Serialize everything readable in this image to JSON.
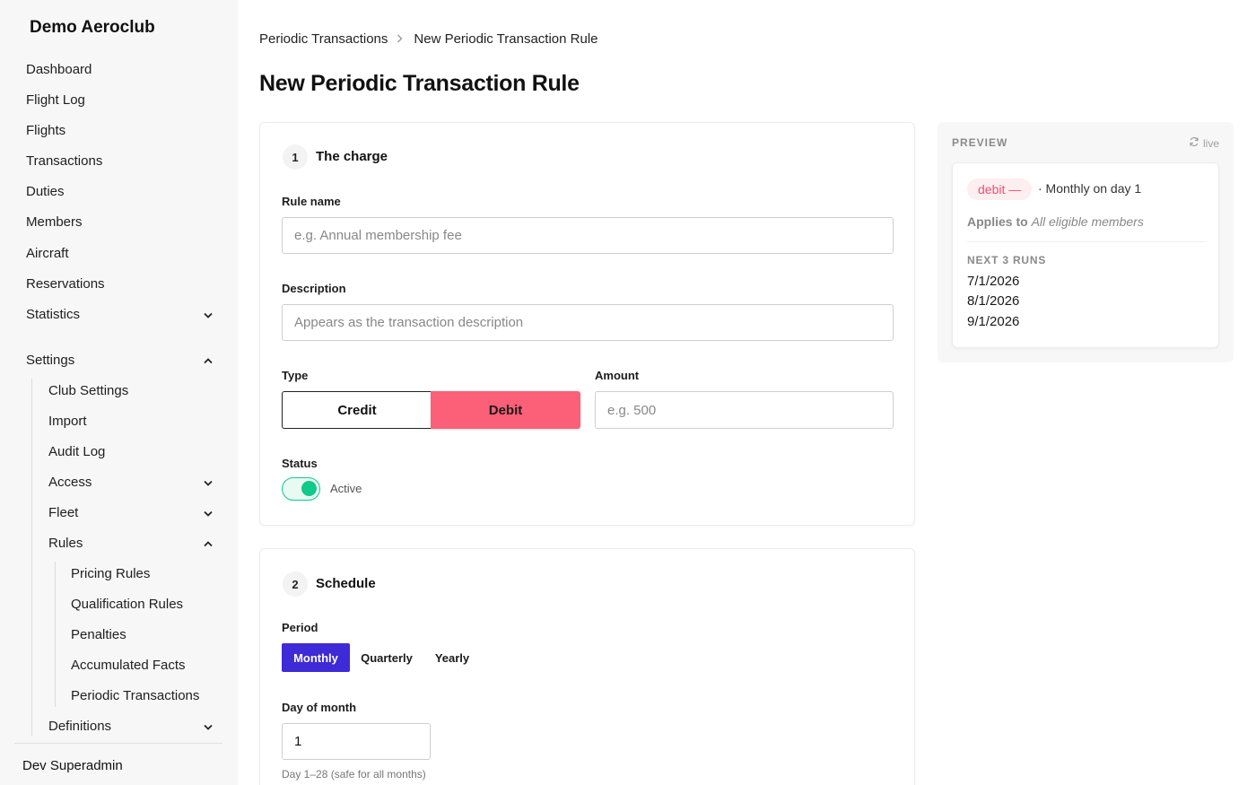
{
  "sidebar": {
    "club_name": "Demo Aeroclub",
    "items": [
      {
        "label": "Dashboard"
      },
      {
        "label": "Flight Log"
      },
      {
        "label": "Flights"
      },
      {
        "label": "Transactions"
      },
      {
        "label": "Duties"
      },
      {
        "label": "Members"
      },
      {
        "label": "Aircraft"
      },
      {
        "label": "Reservations"
      },
      {
        "label": "Statistics",
        "expanded": false
      },
      {
        "label": "Settings",
        "expanded": true
      }
    ],
    "settings_children": [
      {
        "label": "Club Settings"
      },
      {
        "label": "Import"
      },
      {
        "label": "Audit Log"
      },
      {
        "label": "Access",
        "expanded": false
      },
      {
        "label": "Fleet",
        "expanded": false
      },
      {
        "label": "Rules",
        "expanded": true
      },
      {
        "label": "Definitions",
        "expanded": false
      }
    ],
    "rules_children": [
      {
        "label": "Pricing Rules"
      },
      {
        "label": "Qualification Rules"
      },
      {
        "label": "Penalties"
      },
      {
        "label": "Accumulated Facts"
      },
      {
        "label": "Periodic Transactions"
      }
    ],
    "user_name": "Dev Superadmin"
  },
  "breadcrumb": [
    "Periodic Transactions",
    "New Periodic Transaction Rule"
  ],
  "page_title": "New Periodic Transaction Rule",
  "charge": {
    "step": "1",
    "title": "The charge",
    "rule_name_label": "Rule name",
    "rule_name_placeholder": "e.g. Annual membership fee",
    "description_label": "Description",
    "description_placeholder": "Appears as the transaction description",
    "type_label": "Type",
    "type_options": [
      "Credit",
      "Debit"
    ],
    "type_selected": "Debit",
    "amount_label": "Amount",
    "amount_placeholder": "e.g. 500",
    "status_label": "Status",
    "status_value": "Active",
    "status_on": true
  },
  "schedule": {
    "step": "2",
    "title": "Schedule",
    "period_label": "Period",
    "period_options": [
      "Monthly",
      "Quarterly",
      "Yearly"
    ],
    "period_selected": "Monthly",
    "day_label": "Day of month",
    "day_value": "1",
    "day_hint": "Day 1–28 (safe for all months)"
  },
  "preview": {
    "heading": "PREVIEW",
    "live_label": "live",
    "badge": "debit —",
    "schedule_text": "· Monthly on day 1",
    "applies_prefix": "Applies to",
    "applies_target": "All eligible members",
    "runs_heading": "NEXT 3 RUNS",
    "runs": [
      "7/1/2026",
      "8/1/2026",
      "9/1/2026"
    ]
  },
  "colors": {
    "debit_accent": "#fc5f78",
    "period_accent": "#3e2ad6",
    "toggle_on": "#10c98a"
  }
}
